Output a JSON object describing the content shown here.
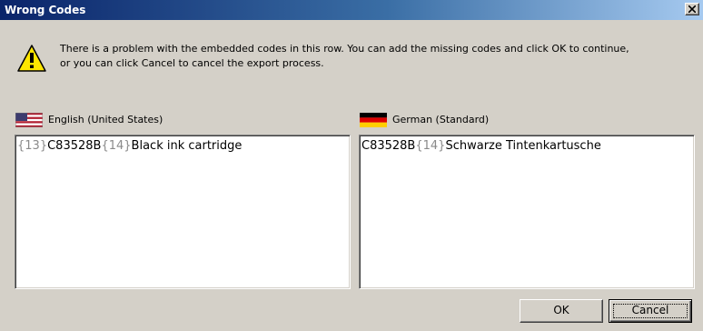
{
  "window": {
    "title": "Wrong Codes"
  },
  "message": {
    "line1": "There is a problem with the embedded codes in this row. You can add the missing codes and click OK to continue,",
    "line2": "or you can click Cancel to cancel the export process."
  },
  "source": {
    "language": "English (United States)",
    "flag": "us-flag-icon",
    "segments": [
      {
        "text": "{13}",
        "code": true
      },
      {
        "text": "C83528B",
        "code": false
      },
      {
        "text": "{14}",
        "code": true
      },
      {
        "text": "Black ink cartridge",
        "code": false
      }
    ]
  },
  "target": {
    "language": "German (Standard)",
    "flag": "german-flag-icon",
    "segments": [
      {
        "text": "C83528B",
        "code": false
      },
      {
        "text": "{14}",
        "code": true
      },
      {
        "text": "Schwarze Tintenkartusche",
        "code": false
      }
    ]
  },
  "buttons": {
    "ok": "OK",
    "cancel": "Cancel"
  },
  "colors": {
    "title_start": "#0a246a",
    "title_end": "#a6caf0",
    "code_text": "#8a8a8a",
    "dialog_bg": "#d4d0c8"
  }
}
